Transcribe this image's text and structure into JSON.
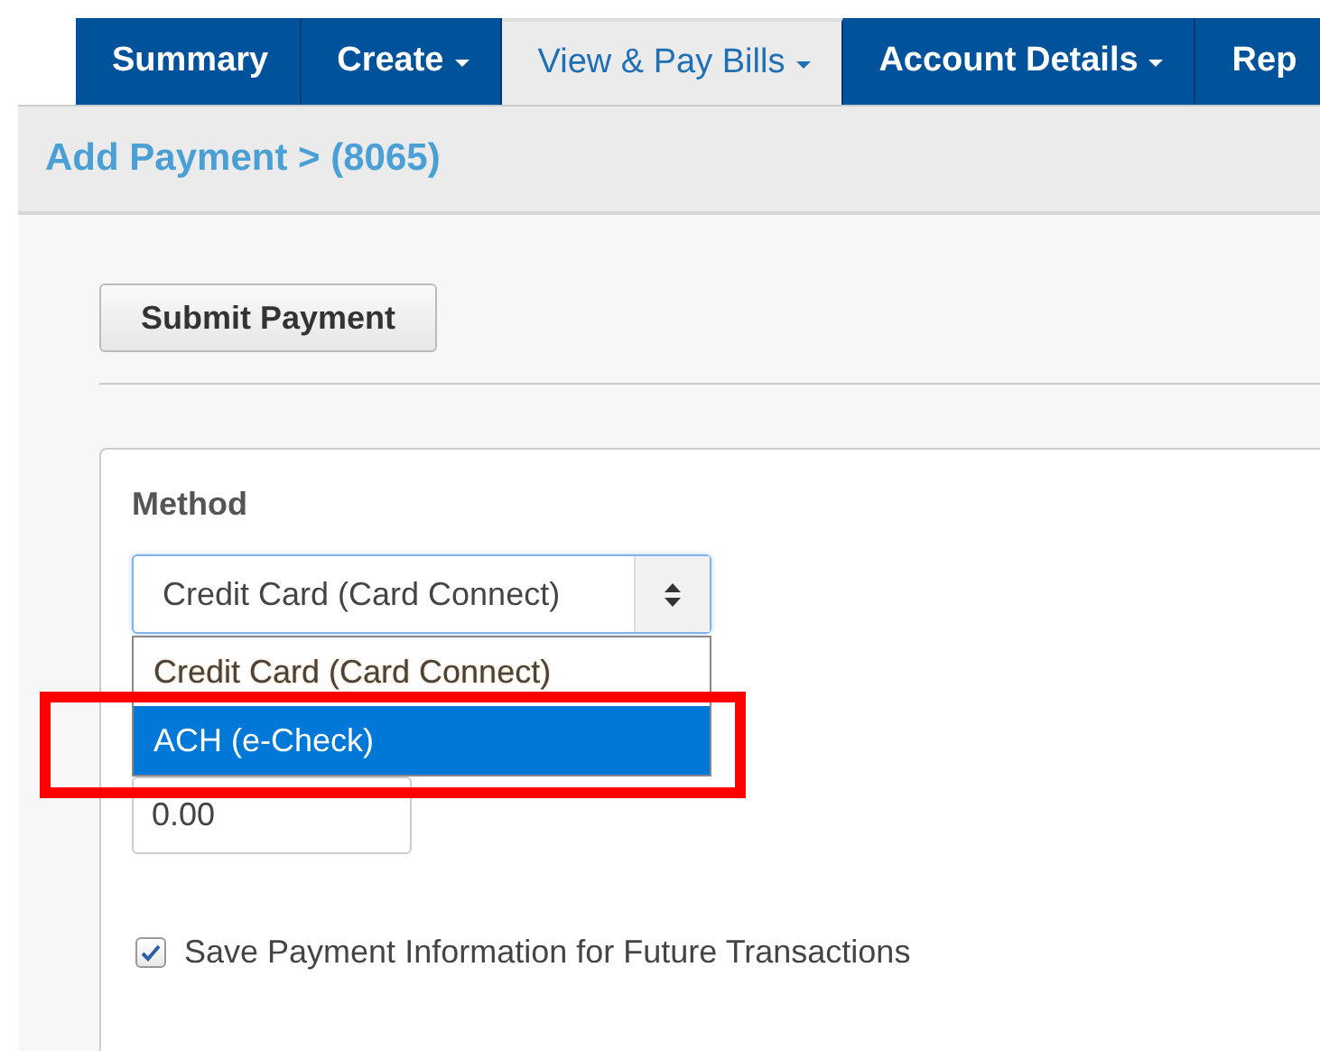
{
  "nav_tabs": [
    {
      "label": "Summary",
      "caret": false,
      "selected": false
    },
    {
      "label": "Create",
      "caret": true,
      "selected": false
    },
    {
      "label": "View & Pay Bills",
      "caret": true,
      "selected": true
    },
    {
      "label": "Account Details",
      "caret": true,
      "selected": false
    },
    {
      "label": "Rep",
      "caret": false,
      "selected": false
    }
  ],
  "breadcrumb": "Add Payment > (8065)",
  "submit_button": "Submit Payment",
  "method": {
    "label": "Method",
    "value": "Credit Card (Card Connect)",
    "expanded": true,
    "options": [
      {
        "label": "Credit Card (Card Connect)",
        "chosen": true,
        "highlighted": false
      },
      {
        "label": "ACH (e-Check)",
        "chosen": false,
        "highlighted": true
      }
    ]
  },
  "amount": {
    "value": "0.00"
  },
  "save_info": {
    "label": "Save Payment Information for Future Transactions",
    "checked": true
  }
}
